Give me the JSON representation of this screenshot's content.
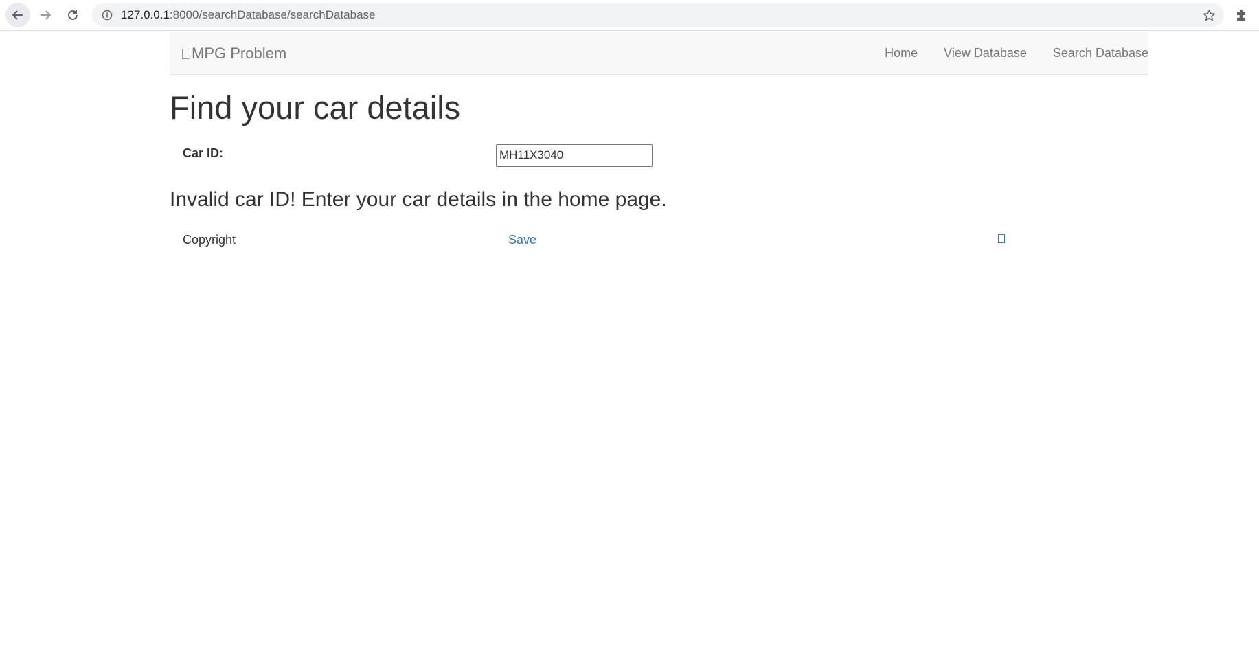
{
  "browser": {
    "url_host": "127.0.0.1",
    "url_rest": ":8000/searchDatabase/searchDatabase"
  },
  "navbar": {
    "brand": "MPG Problem",
    "links": [
      "Home",
      "View Database",
      "Search Database"
    ]
  },
  "main": {
    "title": "Find your car details",
    "car_id_label": "Car ID:",
    "car_id_value": "MH11X3040",
    "message": "Invalid car ID! Enter your car details in the home page."
  },
  "footer": {
    "copyright": "Copyright",
    "save_link": "Save"
  },
  "colors": {
    "link": "#337ab7",
    "navbar_bg": "#f8f8f8",
    "nav_text": "#777777",
    "text": "#333333"
  },
  "icons": [
    "back-arrow-icon",
    "forward-arrow-icon",
    "reload-icon",
    "site-info-icon",
    "bookmark-star-icon",
    "extensions-puzzle-icon",
    "missing-glyph-icon"
  ]
}
